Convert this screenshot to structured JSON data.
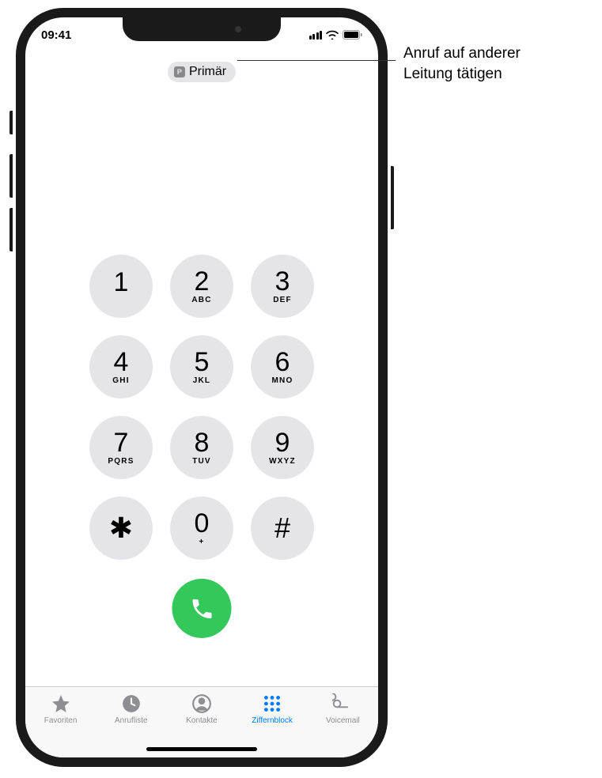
{
  "status": {
    "time": "09:41"
  },
  "line_selector": {
    "badge": "P",
    "label": "Primär"
  },
  "callout": {
    "line1": "Anruf auf anderer",
    "line2": "Leitung tätigen"
  },
  "keypad": [
    {
      "digit": "1",
      "letters": ""
    },
    {
      "digit": "2",
      "letters": "ABC"
    },
    {
      "digit": "3",
      "letters": "DEF"
    },
    {
      "digit": "4",
      "letters": "GHI"
    },
    {
      "digit": "5",
      "letters": "JKL"
    },
    {
      "digit": "6",
      "letters": "MNO"
    },
    {
      "digit": "7",
      "letters": "PQRS"
    },
    {
      "digit": "8",
      "letters": "TUV"
    },
    {
      "digit": "9",
      "letters": "WXYZ"
    },
    {
      "digit": "✱",
      "letters": ""
    },
    {
      "digit": "0",
      "letters": "+"
    },
    {
      "digit": "#",
      "letters": ""
    }
  ],
  "tabs": {
    "favorites": "Favoriten",
    "recents": "Anrufliste",
    "contacts": "Kontakte",
    "keypad": "Ziffernblock",
    "voicemail": "Voicemail"
  },
  "active_tab": "keypad"
}
